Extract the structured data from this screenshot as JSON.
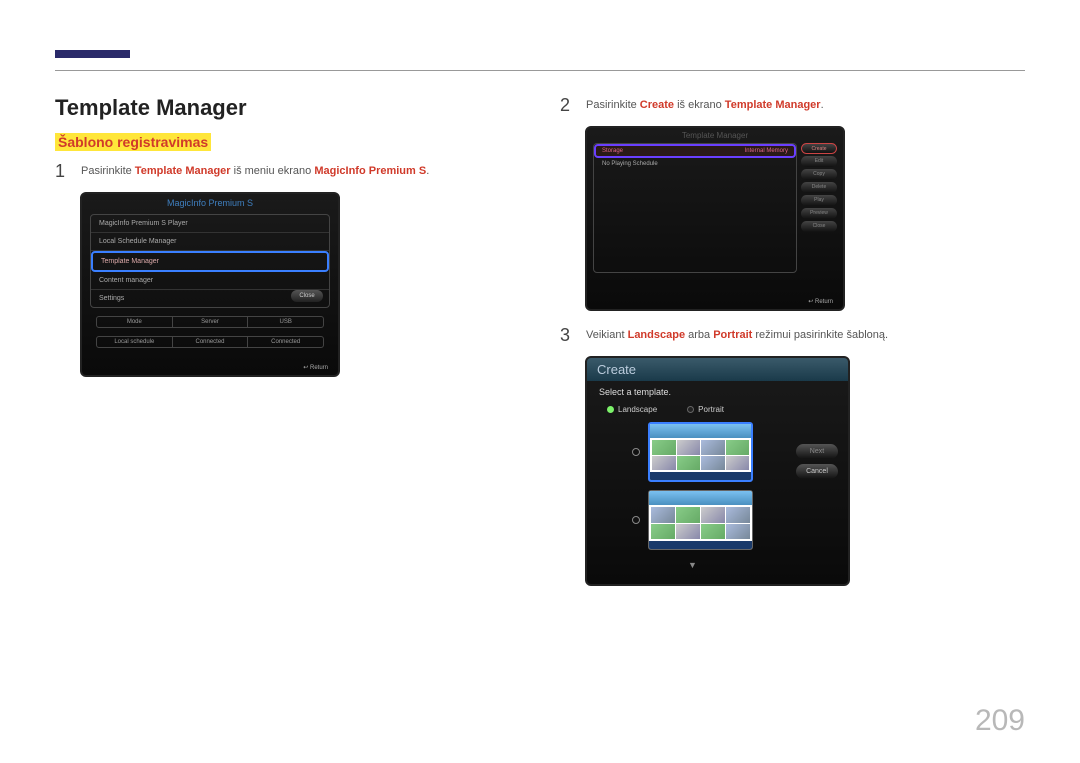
{
  "page_number": "209",
  "title": "Template Manager",
  "subtitle": "Šablono registravimas",
  "step1": {
    "num": "1",
    "t1": "Pasirinkite ",
    "b1": "Template Manager",
    "t2": " iš meniu ekrano ",
    "b2": "MagicInfo Premium S",
    "t3": "."
  },
  "step2": {
    "num": "2",
    "t1": "Pasirinkite ",
    "b1": "Create",
    "t2": " iš ekrano ",
    "b2": "Template Manager",
    "t3": "."
  },
  "step3": {
    "num": "3",
    "t1": "Veikiant ",
    "b1": "Landscape",
    "t2": " arba ",
    "b2": "Portrait",
    "t3": " režimui pasirinkite šabloną."
  },
  "shot1": {
    "title": "MagicInfo Premium S",
    "items": [
      "MagicInfo Premium S Player",
      "Local Schedule Manager",
      "Template Manager",
      "Content manager",
      "Settings"
    ],
    "close": "Close",
    "status_h": [
      "Mode",
      "Server",
      "USB"
    ],
    "status_v": [
      "Local schedule",
      "Connected",
      "Connected"
    ],
    "return": "Return"
  },
  "shot2": {
    "title": "Template Manager",
    "storage": "Storage",
    "memory": "Internal Memory",
    "schedule": "No Playing Schedule",
    "btns": [
      "Create",
      "Edit",
      "Copy",
      "Delete",
      "Play",
      "Preview",
      "Close"
    ],
    "return": "Return"
  },
  "shot3": {
    "title": "Create",
    "select": "Select a template.",
    "landscape": "Landscape",
    "portrait": "Portrait",
    "next": "Next",
    "cancel": "Cancel"
  }
}
